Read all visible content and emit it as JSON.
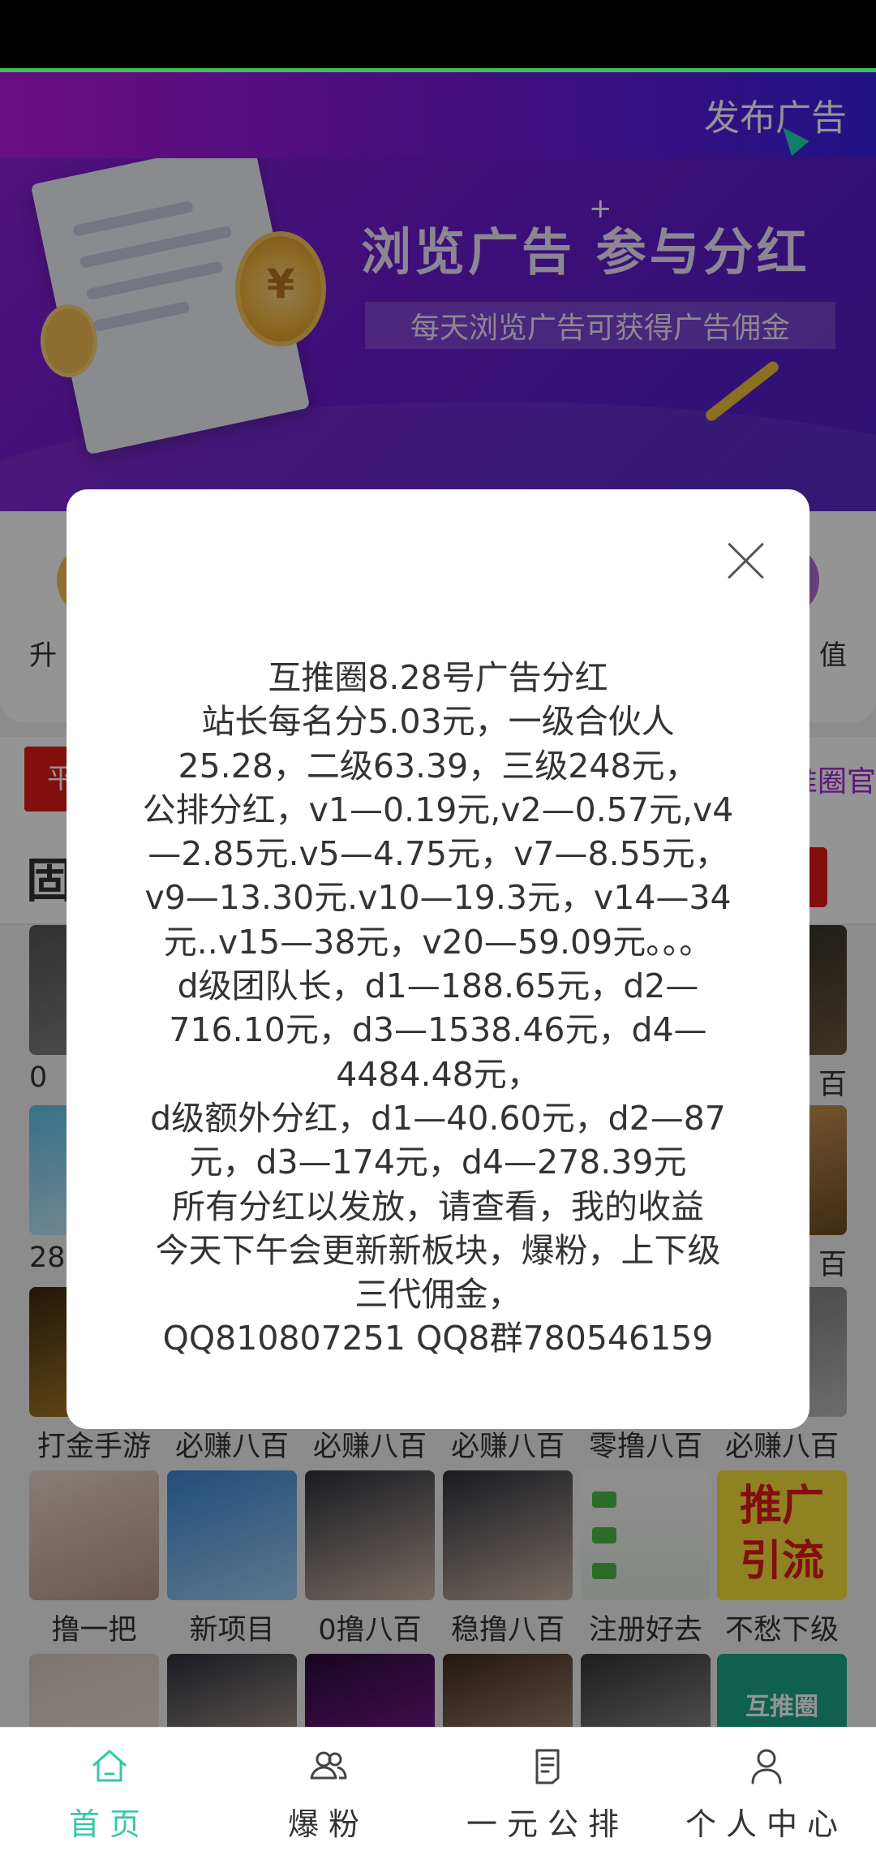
{
  "header": {
    "title": "发布广告"
  },
  "banner": {
    "title": "浏览广告 参与分红",
    "subtitle": "每天浏览广告可获得广告佣金",
    "coin_symbol": "¥"
  },
  "quick_entries": {
    "left_partial": "升",
    "right_partial": "值"
  },
  "notice": {
    "badge_partial": "平",
    "right_partial": "推圈官"
  },
  "section": {
    "title_partial": "固"
  },
  "grid": {
    "rows_partial": [
      {
        "left_label": "0",
        "right_label": "百"
      },
      {
        "left_label": "28",
        "right_label": "百"
      }
    ],
    "row3": [
      "打金手游",
      "必赚八百",
      "必赚八百",
      "必赚八百",
      "零撸八百",
      "必赚八百"
    ],
    "row4": [
      "撸一把",
      "新项目",
      "0撸八百",
      "稳撸八百",
      "注册好去",
      "不愁下级"
    ],
    "promo_tile_text": [
      "推广",
      "引流"
    ],
    "row5_tile_text": "互推圈"
  },
  "modal": {
    "lines": [
      "互推圈8.28号广告分红",
      "站长每名分5.03元，一级合伙人",
      "25.28，二级63.39，三级248元，",
      "公排分红，v1—0.19元,v2—0.57元,v4",
      "—2.85元.v5—4.75元，v7—8.55元，",
      "v9—13.30元.v10—19.3元，v14—34",
      "元..v15—38元，v20—59.09元。。。",
      "d级团队长，d1—188.65元，d2—",
      "716.10元，d3—1538.46元，d4—",
      "4484.48元，",
      "d级额外分红，d1—40.60元，d2—87",
      "元，d3—174元，d4—278.39元",
      "所有分红以发放，请查看，我的收益",
      "今天下午会更新新板块，爆粉，上下级",
      "三代佣金，",
      "QQ810807251   QQ8群780546159"
    ]
  },
  "tabbar": {
    "items": [
      {
        "label": "首页",
        "icon": "home-icon",
        "active": true
      },
      {
        "label": "爆粉",
        "icon": "users-icon",
        "active": false
      },
      {
        "label": "一元公排",
        "icon": "document-icon",
        "active": false
      },
      {
        "label": "个人中心",
        "icon": "person-icon",
        "active": false
      }
    ]
  },
  "colors": {
    "accent": "#35c7a6",
    "header_start": "#b617e0",
    "header_end": "#3a20e6",
    "alert_red": "#e01919"
  }
}
